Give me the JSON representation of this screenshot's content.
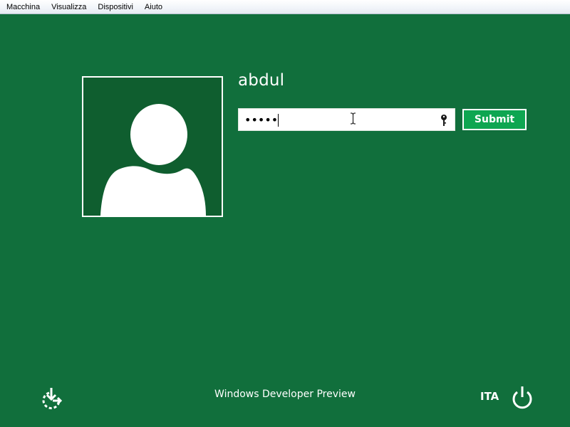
{
  "menubar": {
    "items": [
      "Macchina",
      "Visualizza",
      "Dispositivi",
      "Aiuto"
    ]
  },
  "login": {
    "username": "abdul",
    "password_masked": "•••••",
    "submit_label": "Submit"
  },
  "footer": {
    "brand_text": "Windows Developer Preview",
    "language": "ITA"
  },
  "icons": {
    "avatar": "user-silhouette-icon",
    "password_reveal": "key-icon",
    "ease_of_access": "ease-of-access-icon",
    "power": "power-icon"
  },
  "colors": {
    "background": "#116f3c",
    "avatar_bg": "#0f5e2f",
    "submit_bg": "#0ea651",
    "text": "#ffffff"
  }
}
